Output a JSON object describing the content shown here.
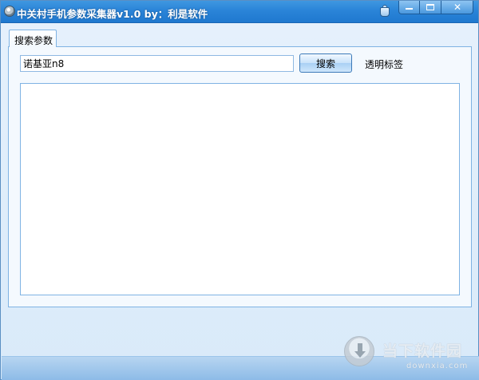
{
  "window": {
    "title": "中关村手机参数采集器v1.0  by：利是软件"
  },
  "tabs": [
    {
      "label": "搜索参数"
    }
  ],
  "search": {
    "value": "诺基亚n8",
    "button_label": "搜索"
  },
  "options": {
    "transparent_label": "透明标签"
  },
  "watermark": {
    "brand": "当下软件园",
    "url": "downxia.com"
  },
  "colors": {
    "titlebar": "#2a84d8",
    "panel_border": "#7fb3e3",
    "background": "#dfeefb"
  }
}
